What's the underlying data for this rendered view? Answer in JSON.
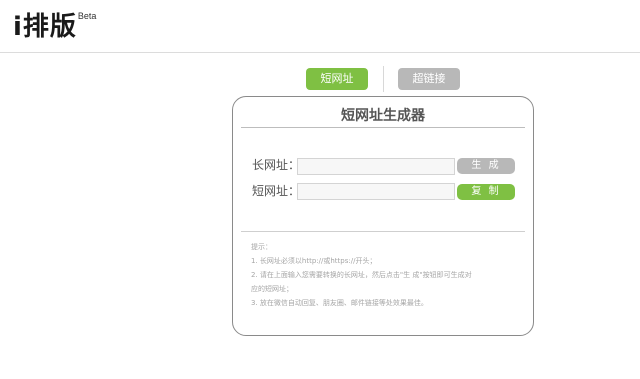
{
  "header": {
    "logo_text": "i排版",
    "beta": "Beta"
  },
  "tabs": {
    "short_url": "短网址",
    "hyperlink": "超链接"
  },
  "card": {
    "title": "短网址生成器",
    "long_url_label": "长网址：",
    "long_url_value": "",
    "generate_button": "生 成",
    "short_url_label": "短网址：",
    "short_url_value": "",
    "copy_button": "复 制"
  },
  "tips": {
    "heading": "提示：",
    "line1": "1. 长网址必须以http://或https://开头；",
    "line2": "2. 请在上面输入您需要转换的长网址，然后点击\"生 成\"按钮即可生成对",
    "line2b": "应的短网址；",
    "line3": "3. 放在微信自动回复、朋友圈、邮件链接等处效果最佳。"
  },
  "colors": {
    "accent_green": "#7fc043",
    "button_gray": "#b8b8b8"
  }
}
